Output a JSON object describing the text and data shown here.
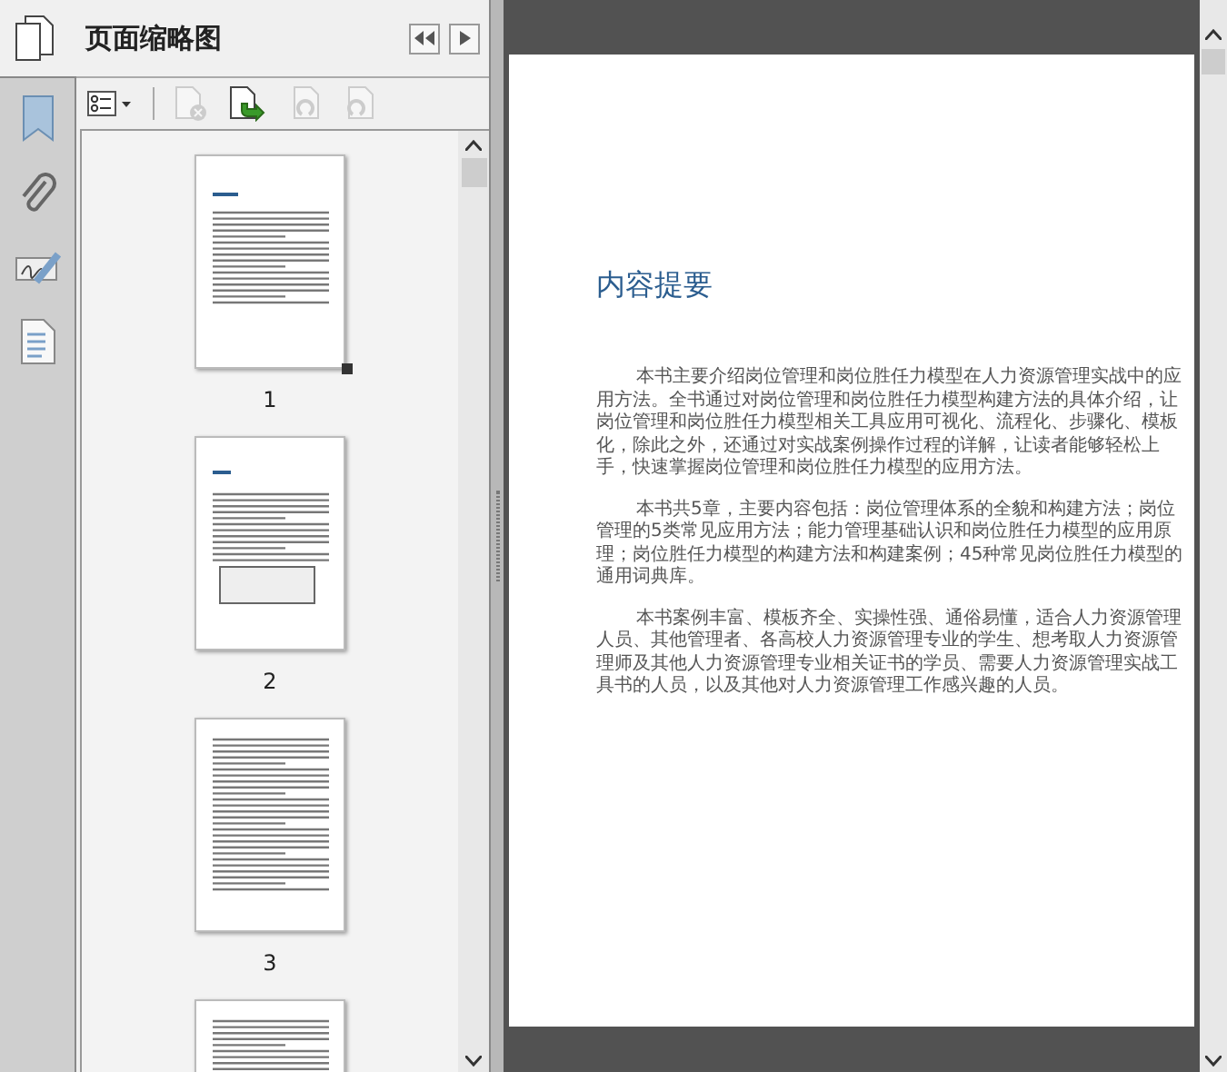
{
  "panel": {
    "title": "页面缩略图"
  },
  "toolbar": [
    {
      "kind": "options",
      "disabled": false
    },
    {
      "kind": "delete",
      "disabled": true
    },
    {
      "kind": "insert",
      "disabled": false
    },
    {
      "kind": "undo",
      "disabled": true
    },
    {
      "kind": "redo",
      "disabled": true
    }
  ],
  "thumbnails": [
    {
      "label": "1",
      "selected": true
    },
    {
      "label": "2",
      "selected": false
    },
    {
      "label": "3",
      "selected": false
    },
    {
      "selected": false
    }
  ],
  "document": {
    "heading": "内容提要",
    "paragraphs": [
      "本书主要介绍岗位管理和岗位胜任力模型在人力资源管理实战中的应用方法。全书通过对岗位管理和岗位胜任力模型构建方法的具体介绍，让岗位管理和岗位胜任力模型相关工具应用可视化、流程化、步骤化、模板化，除此之外，还通过对实战案例操作过程的详解，让读者能够轻松上手，快速掌握岗位管理和岗位胜任力模型的应用方法。",
      "本书共5章，主要内容包括：岗位管理体系的全貌和构建方法；岗位管理的5类常见应用方法；能力管理基础认识和岗位胜任力模型的应用原理；岗位胜任力模型的构建方法和构建案例；45种常见岗位胜任力模型的通用词典库。",
      "本书案例丰富、模板齐全、实操性强、通俗易懂，适合人力资源管理人员、其他管理者、各高校人力资源管理专业的学生、想考取人力资源管理师及其他人力资源管理专业相关证书的学员、需要人力资源管理实战工具书的人员，以及其他对人力资源管理工作感兴趣的人员。"
    ]
  }
}
